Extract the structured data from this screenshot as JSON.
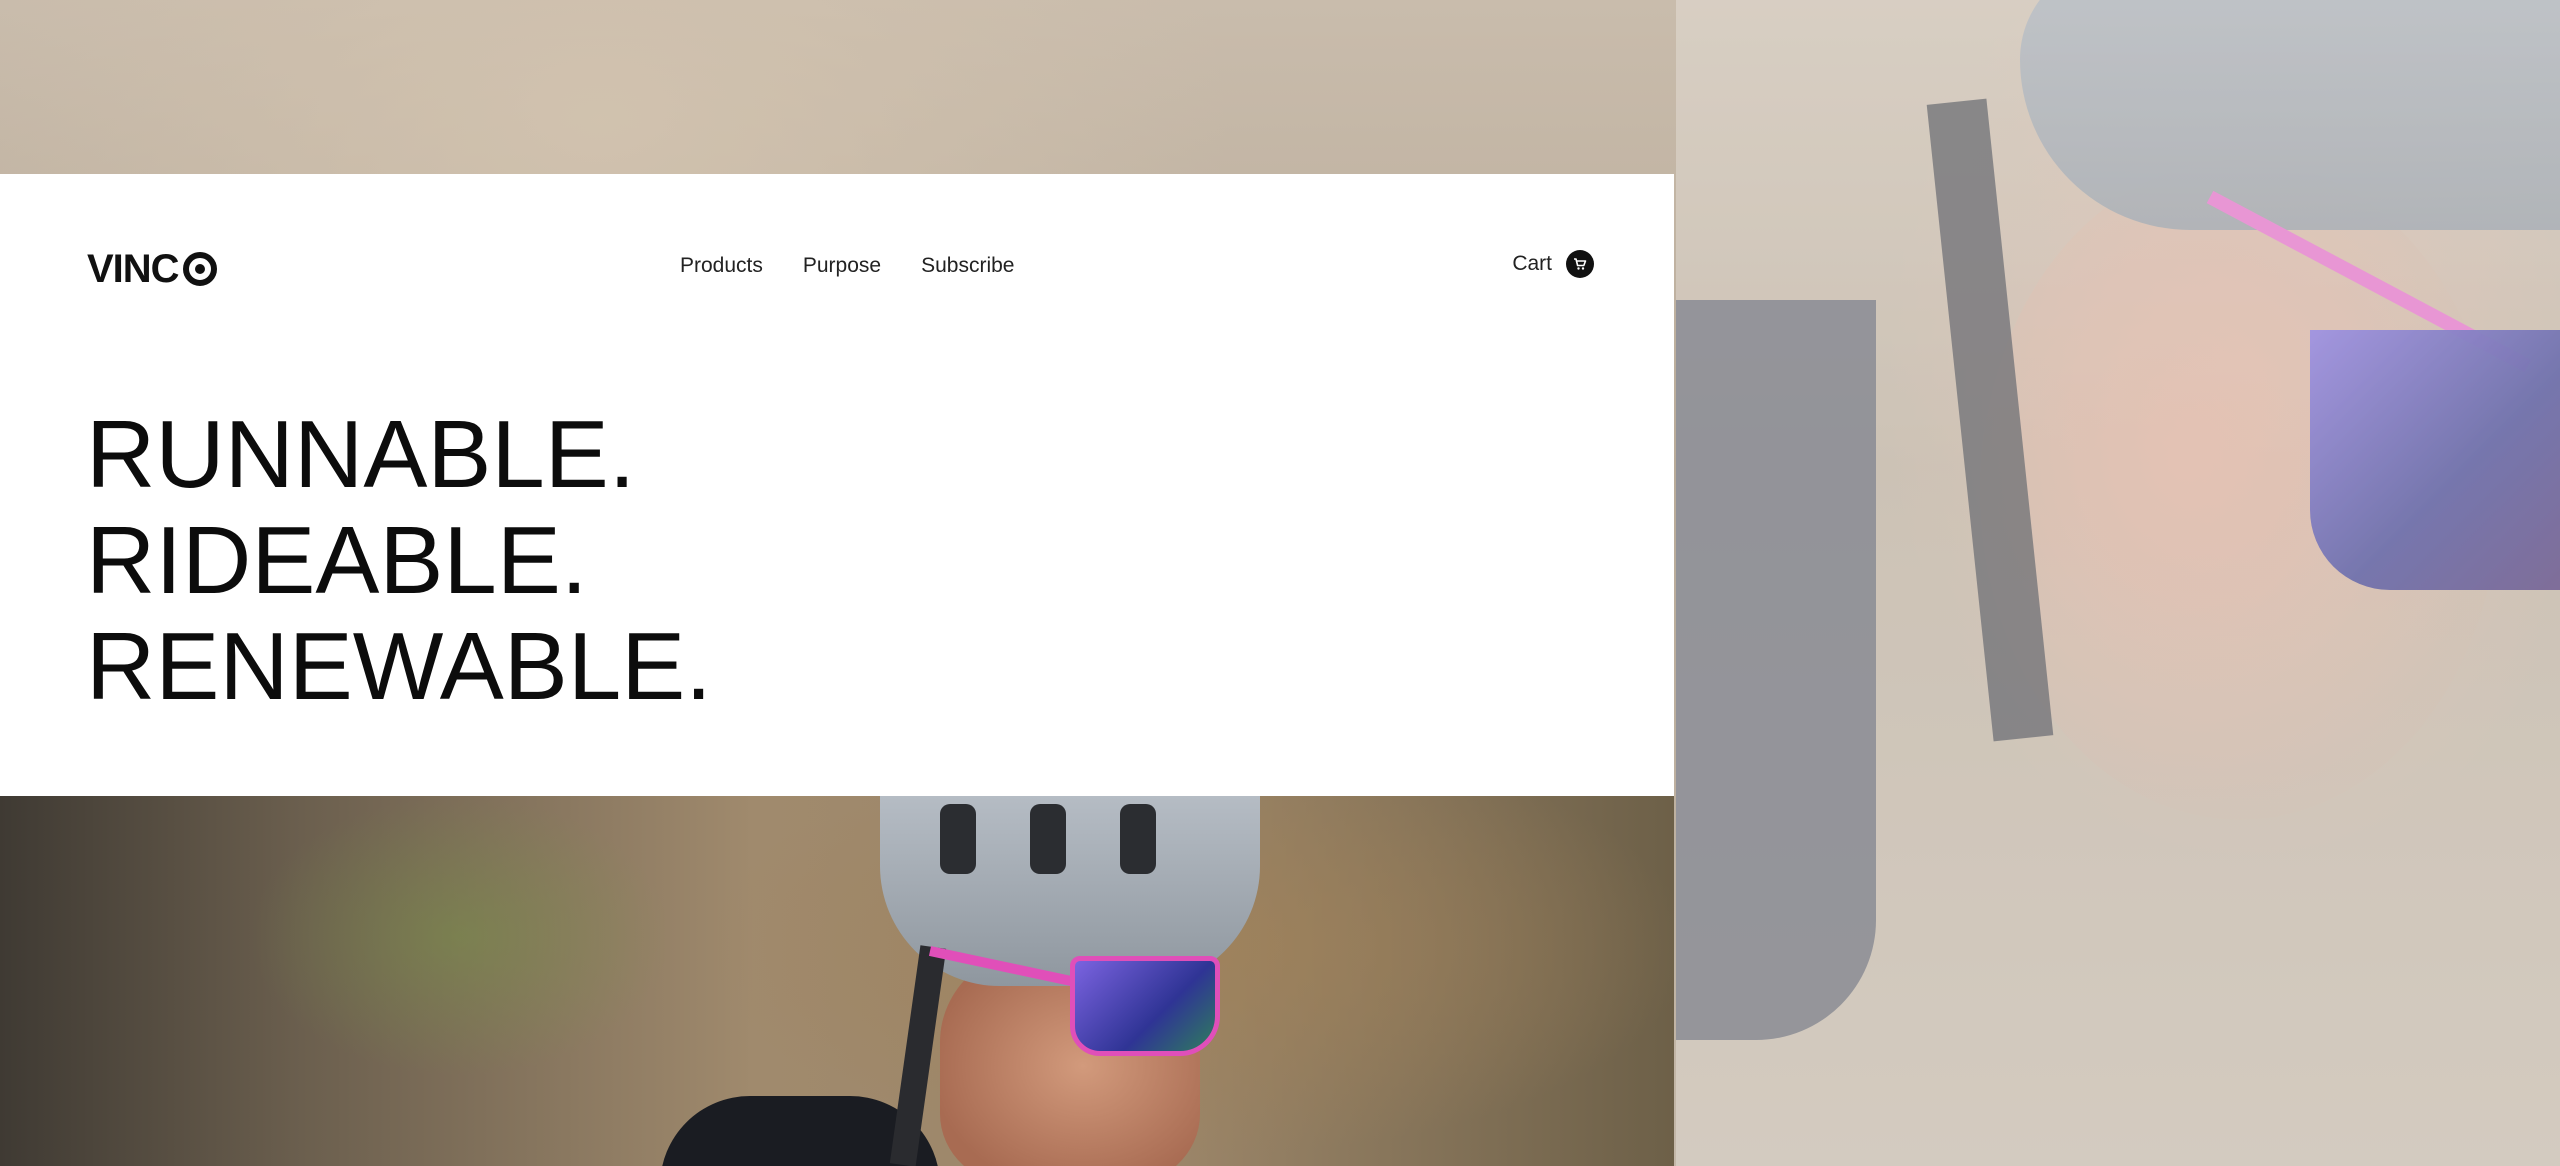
{
  "brand": {
    "logo_text": "VINC",
    "logo_mark": "O"
  },
  "nav": {
    "items": [
      {
        "label": "Products"
      },
      {
        "label": "Purpose"
      },
      {
        "label": "Subscribe"
      }
    ]
  },
  "cart": {
    "label": "Cart",
    "icon": "cart-icon"
  },
  "hero": {
    "lines": [
      "RUNNABLE.",
      "RIDEABLE.",
      "RENEWABLE."
    ]
  },
  "colors": {
    "text": "#0c0c0c",
    "card_bg": "#ffffff",
    "accent_lens": "#5b4fd0",
    "accent_frame": "#e04fb9"
  }
}
